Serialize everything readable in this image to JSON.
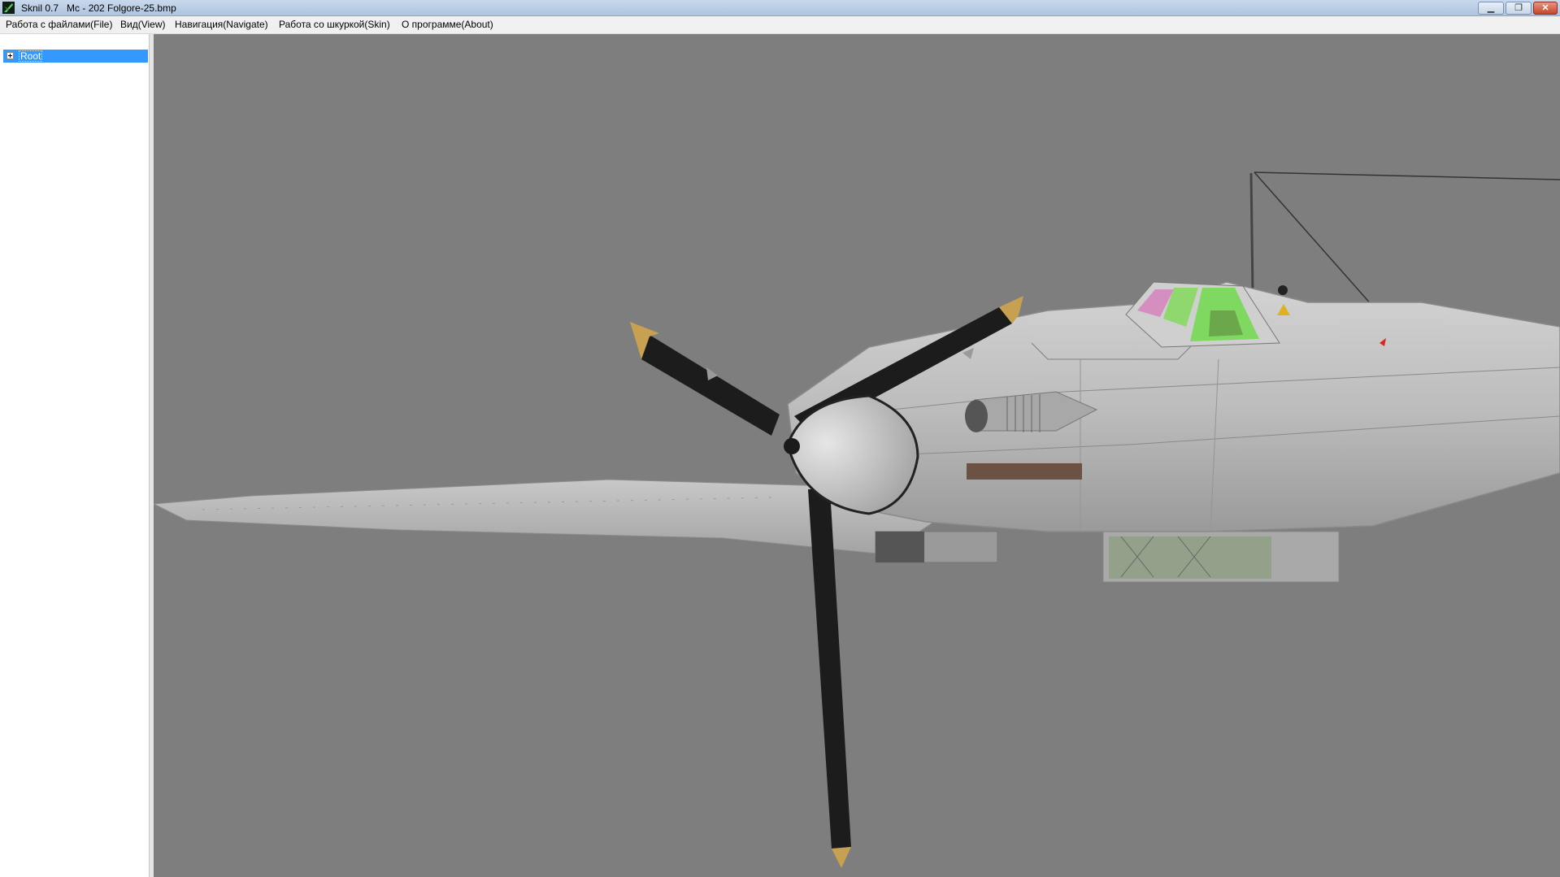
{
  "window": {
    "title": "Sknil 0.7   Mc - 202 Folgore-25.bmp",
    "icon": "app-icon",
    "controls": {
      "minimize": "minimize-icon",
      "maximize": "restore-icon",
      "close": "close-icon"
    }
  },
  "menu": {
    "file": "Работа с файлами(File)",
    "view": "Вид(View)",
    "navigate": "Навигация(Navigate)",
    "skin": "Работа со шкуркой(Skin)",
    "about": "О программе(About)"
  },
  "tree": {
    "root_label": "Root",
    "expander": "plus-expander-icon",
    "selected": true
  },
  "viewport": {
    "background": "#7e7e7e",
    "model": "Mc - 202 Folgore",
    "skin_file": "Folgore-25.bmp"
  },
  "colors": {
    "title_gradient_top": "#c9d9ec",
    "selection": "#3399ff",
    "fuselage": "#b9b9b9",
    "propeller": "#1c1c1c",
    "prop_tip": "#c7a052",
    "canopy_glass": "#7fd860"
  }
}
